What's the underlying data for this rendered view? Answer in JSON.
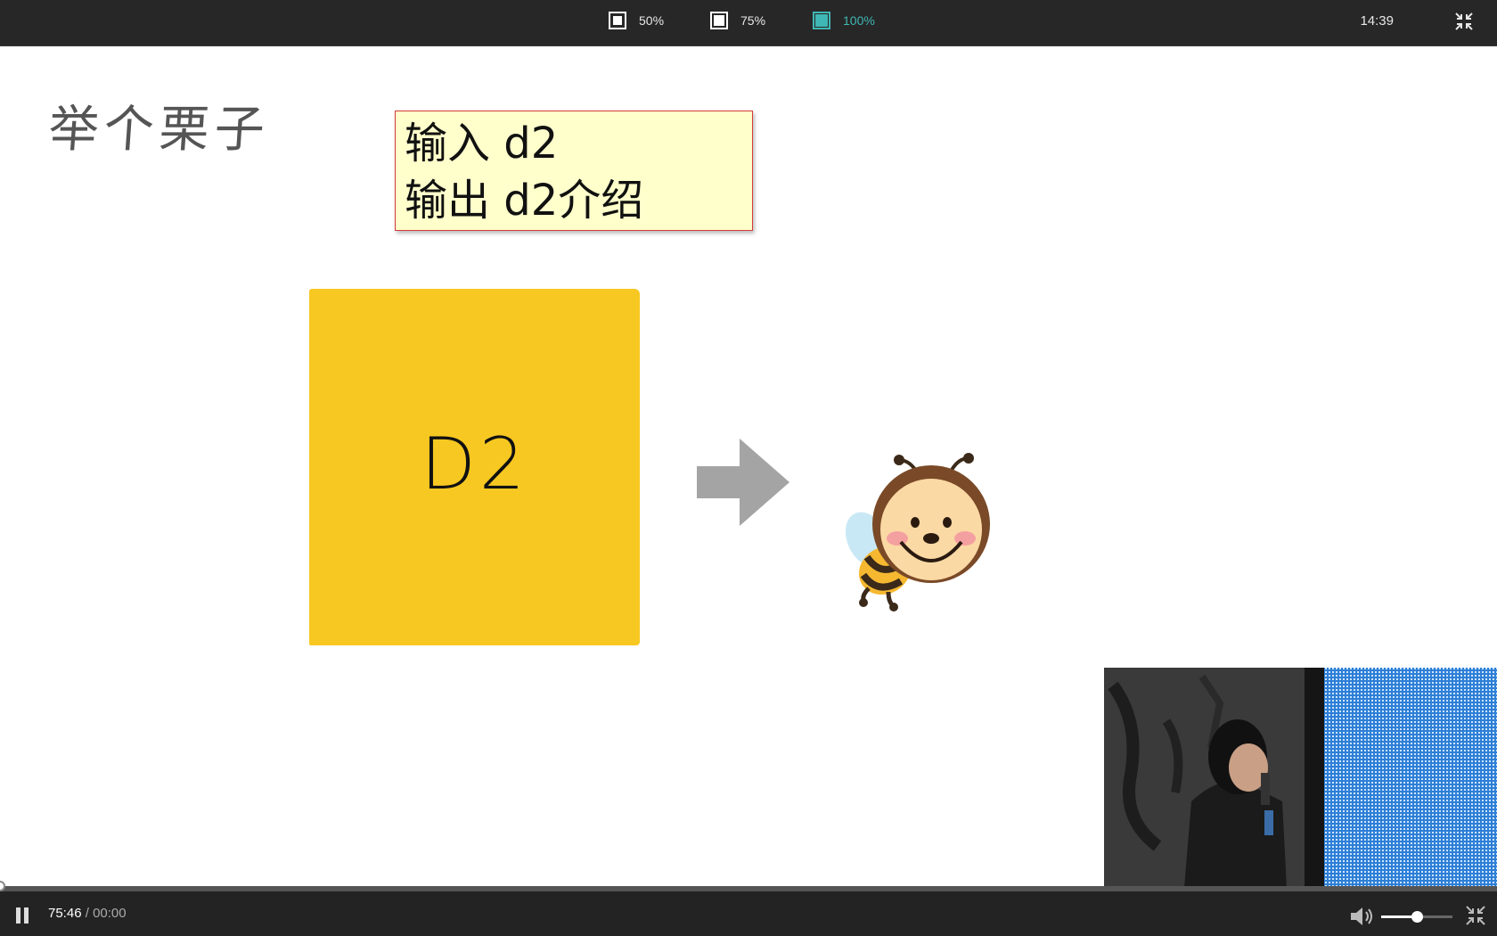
{
  "toolbar": {
    "zoom_options": [
      {
        "label": "50%",
        "active": false
      },
      {
        "label": "75%",
        "active": false
      },
      {
        "label": "100%",
        "active": true
      }
    ],
    "clock": "14:39",
    "exit_fullscreen_icon": "collapse-arrows-icon"
  },
  "slide": {
    "title": "举个栗子",
    "note_lines": [
      "输入 d2",
      "输出 d2介绍"
    ],
    "card_text": "D2",
    "arrow_icon": "right-arrow-icon",
    "mascot": "bee-icon"
  },
  "player": {
    "current_time": "75:46",
    "separator": " / ",
    "duration": "00:00",
    "progress": 0,
    "volume": 0.5,
    "play_state_icon": "pause-icon",
    "volume_icon": "speaker-icon"
  },
  "colors": {
    "accent": "#3fb7b4",
    "card": "#f7c821",
    "note_bg": "#ffffcc",
    "note_border": "#d43a3a"
  }
}
